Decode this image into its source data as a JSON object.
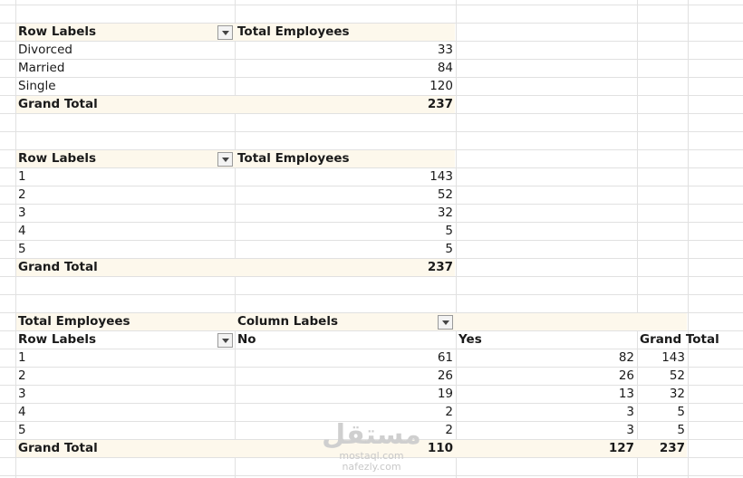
{
  "pivot1": {
    "row_labels": "Row Labels",
    "value_header": "Total Employees",
    "rows": [
      {
        "label": "Divorced",
        "value": "33"
      },
      {
        "label": "Married",
        "value": "84"
      },
      {
        "label": "Single",
        "value": "120"
      }
    ],
    "grand_total_label": "Grand Total",
    "grand_total": "237"
  },
  "pivot2": {
    "row_labels": "Row Labels",
    "value_header": "Total Employees",
    "rows": [
      {
        "label": "1",
        "value": "143"
      },
      {
        "label": "2",
        "value": "52"
      },
      {
        "label": "3",
        "value": "32"
      },
      {
        "label": "4",
        "value": "5"
      },
      {
        "label": "5",
        "value": "5"
      }
    ],
    "grand_total_label": "Grand Total",
    "grand_total": "237"
  },
  "pivot3": {
    "measure": "Total Employees",
    "column_labels": "Column Labels",
    "row_labels": "Row Labels",
    "col_no": "No",
    "col_yes": "Yes",
    "col_total": "Grand Total",
    "rows": [
      {
        "label": "1",
        "no": "61",
        "yes": "82",
        "total": "143"
      },
      {
        "label": "2",
        "no": "26",
        "yes": "26",
        "total": "52"
      },
      {
        "label": "3",
        "no": "19",
        "yes": "13",
        "total": "32"
      },
      {
        "label": "4",
        "no": "2",
        "yes": "3",
        "total": "5"
      },
      {
        "label": "5",
        "no": "2",
        "yes": "3",
        "total": "5"
      }
    ],
    "grand_total_label": "Grand Total",
    "grand_no": "110",
    "grand_yes": "127",
    "grand_total": "237"
  },
  "watermark": {
    "logo_text": "مستقل",
    "line1": "mostaql.com",
    "line2": "nafezly.com"
  }
}
